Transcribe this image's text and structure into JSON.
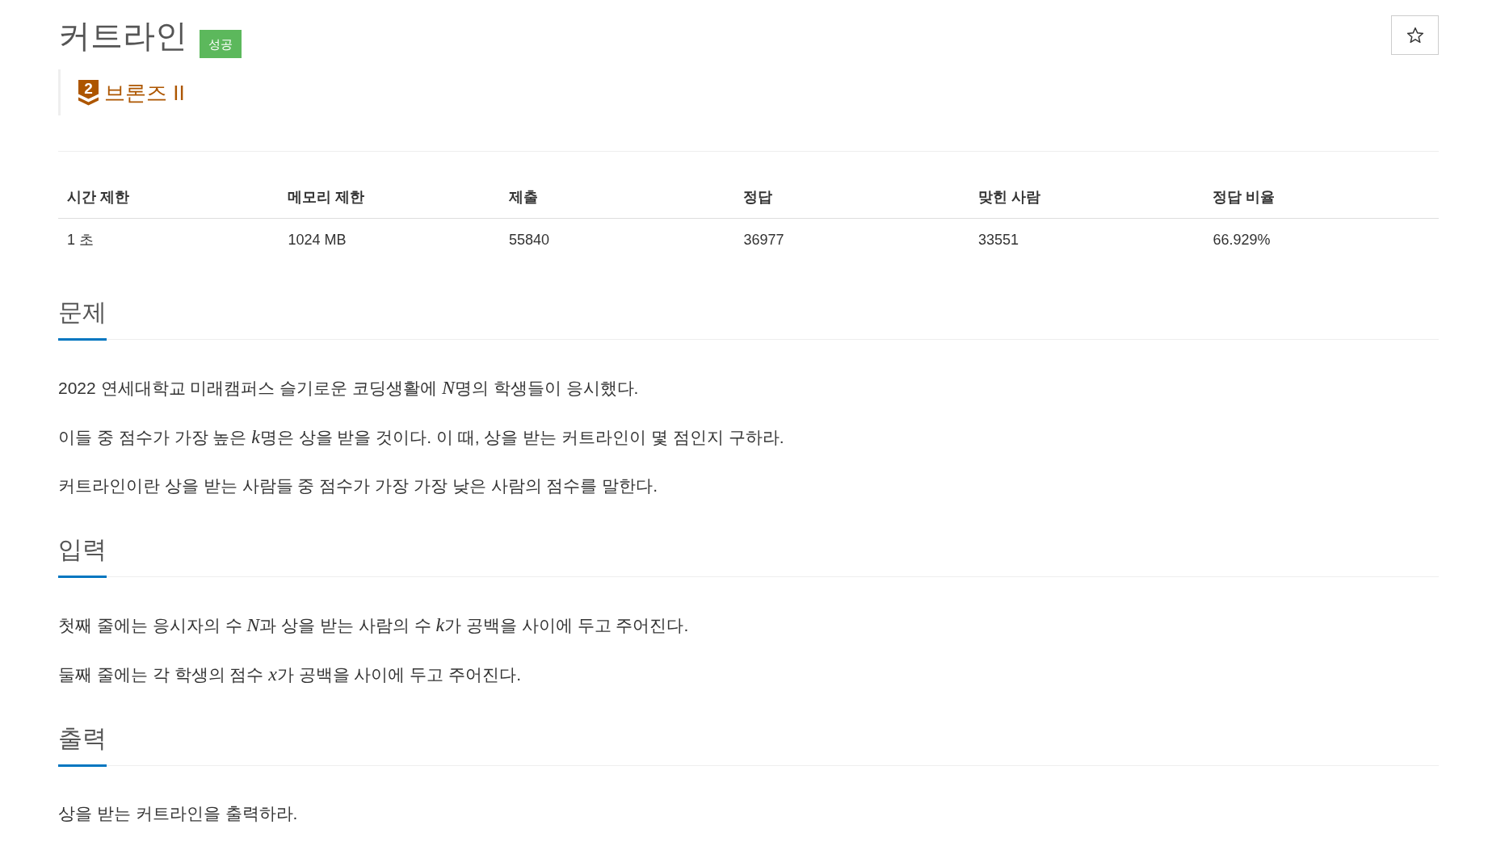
{
  "problem": {
    "title": "커트라인",
    "result_badge": "성공",
    "starred": false
  },
  "tier": {
    "number": "2",
    "name": "브론즈 II"
  },
  "info_table": {
    "columns": [
      "시간 제한",
      "메모리 제한",
      "제출",
      "정답",
      "맞힌 사람",
      "정답 비율"
    ],
    "rows": [
      [
        "1 초",
        "1024 MB",
        "55840",
        "36977",
        "33551",
        "66.929%"
      ]
    ]
  },
  "sections": [
    {
      "heading": "문제",
      "paragraphs": [
        [
          {
            "kind": "text",
            "text": "2022 연세대학교 미래캠퍼스 슬기로운 코딩생활에 "
          },
          {
            "kind": "math",
            "text": "N"
          },
          {
            "kind": "text",
            "text": "명의 학생들이 응시했다."
          }
        ],
        [
          {
            "kind": "text",
            "text": "이들 중 점수가 가장 높은 "
          },
          {
            "kind": "math",
            "text": "k"
          },
          {
            "kind": "text",
            "text": "명은 상을 받을 것이다. 이 때, 상을 받는 커트라인이 몇 점인지 구하라."
          }
        ],
        [
          {
            "kind": "text",
            "text": "커트라인이란 상을 받는 사람들 중 점수가 가장 가장 낮은 사람의 점수를 말한다."
          }
        ]
      ]
    },
    {
      "heading": "입력",
      "paragraphs": [
        [
          {
            "kind": "text",
            "text": "첫째 줄에는 응시자의 수 "
          },
          {
            "kind": "math",
            "text": "N"
          },
          {
            "kind": "text",
            "text": "과 상을 받는 사람의 수 "
          },
          {
            "kind": "math",
            "text": "k"
          },
          {
            "kind": "text",
            "text": "가 공백을 사이에 두고 주어진다."
          }
        ],
        [
          {
            "kind": "text",
            "text": "둘째 줄에는 각 학생의 점수 "
          },
          {
            "kind": "math",
            "text": "x"
          },
          {
            "kind": "text",
            "text": "가 공백을 사이에 두고 주어진다."
          }
        ]
      ]
    },
    {
      "heading": "출력",
      "paragraphs": [
        [
          {
            "kind": "text",
            "text": "상을 받는 커트라인을 출력하라."
          }
        ]
      ]
    }
  ]
}
